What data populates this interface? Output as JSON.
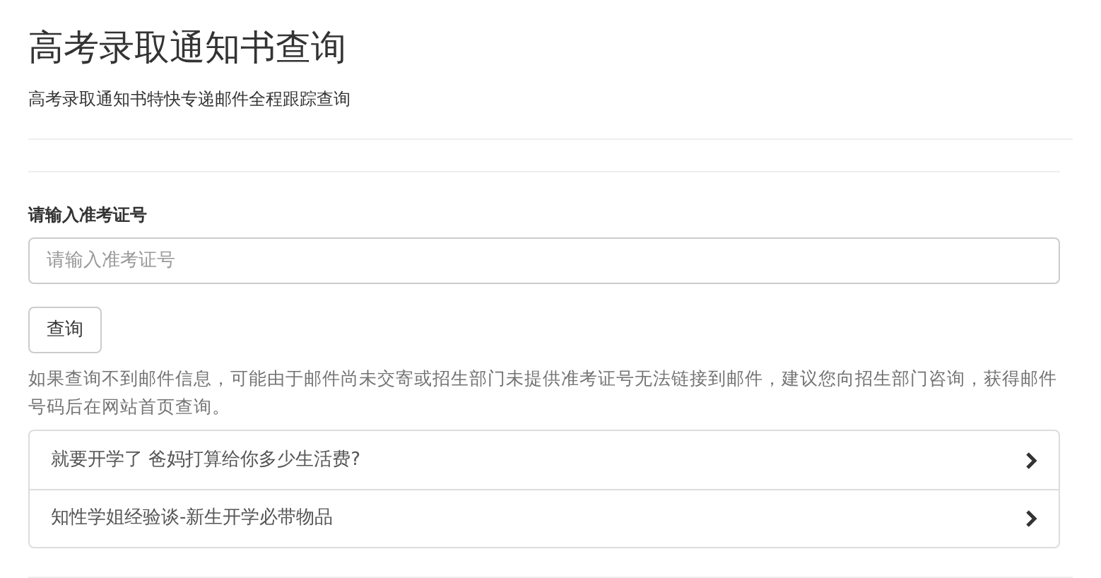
{
  "header": {
    "title": "高考录取通知书查询",
    "subtitle": "高考录取通知书特快专递邮件全程跟踪查询"
  },
  "form": {
    "label": "请输入准考证号",
    "placeholder": "请输入准考证号",
    "button": "查询",
    "help": "如果查询不到邮件信息，可能由于邮件尚未交寄或招生部门未提供准考证号无法链接到邮件，建议您向招生部门咨询，获得邮件号码后在网站首页查询。"
  },
  "links": [
    {
      "text": "就要开学了 爸妈打算给你多少生活费?"
    },
    {
      "text": "知性学姐经验谈-新生开学必带物品"
    }
  ]
}
